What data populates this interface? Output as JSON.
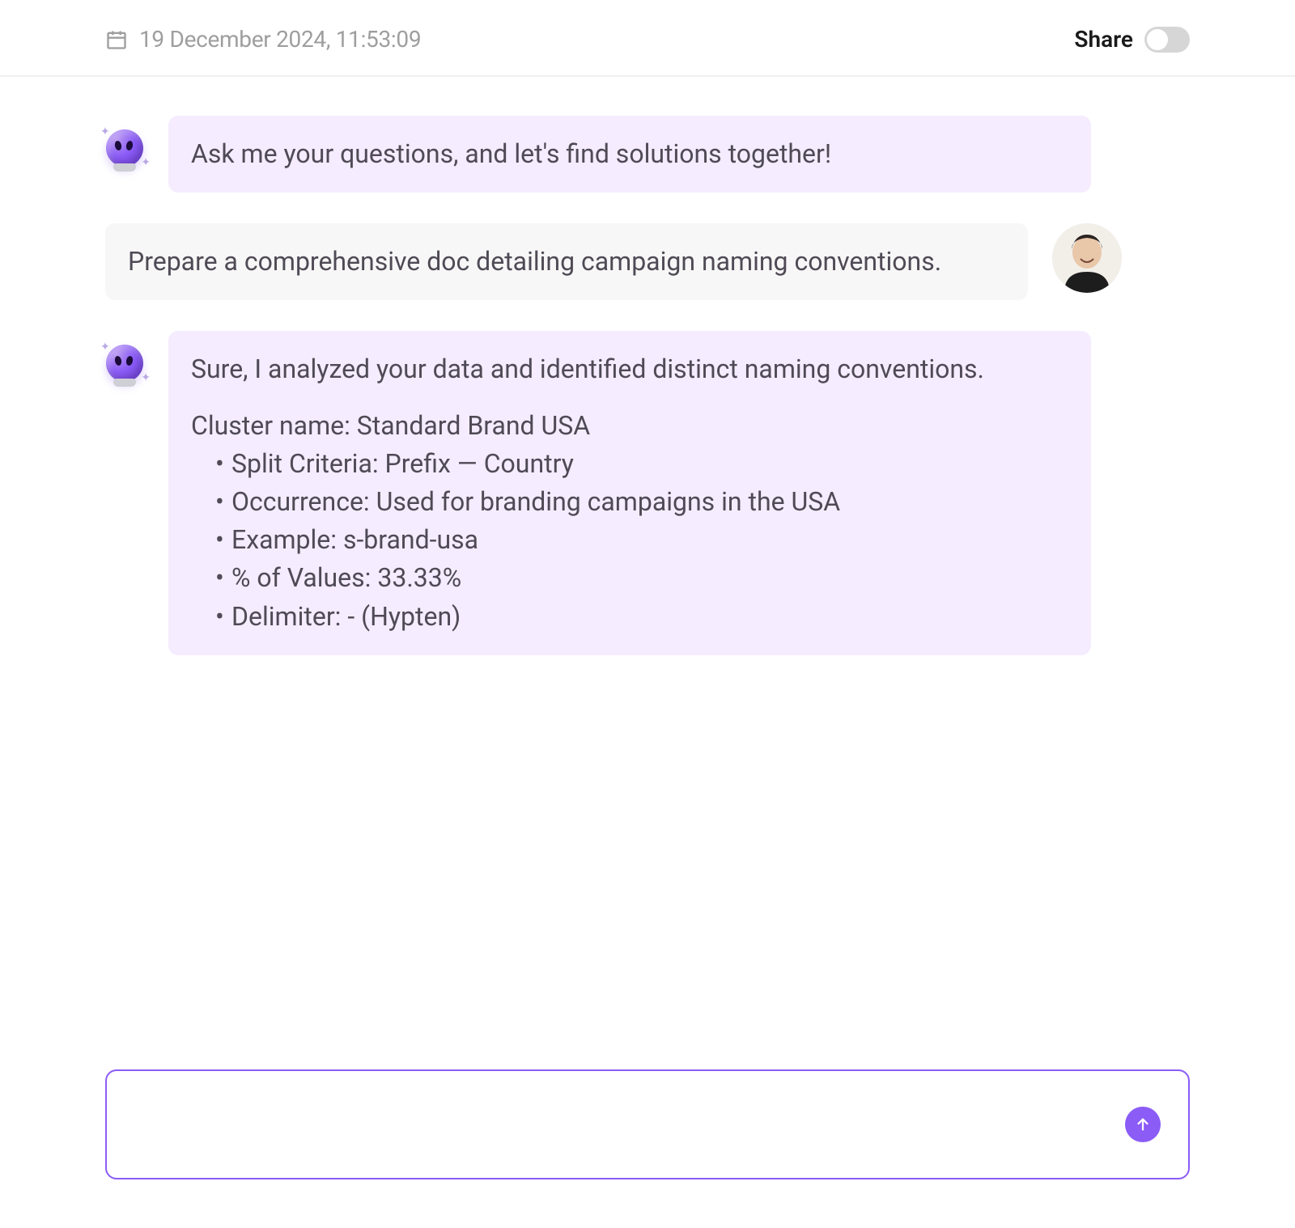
{
  "header": {
    "timestamp": "19 December 2024, 11:53:09",
    "share_label": "Share",
    "share_toggle_on": false
  },
  "chat": {
    "messages": [
      {
        "role": "assistant",
        "text": "Ask me your questions, and let's find solutions together!"
      },
      {
        "role": "user",
        "text": "Prepare a comprehensive doc detailing campaign naming conventions."
      },
      {
        "role": "assistant",
        "lead": "Sure, I analyzed your data and identified distinct naming conventions.",
        "cluster_title": "Cluster name: Standard Brand USA",
        "bullets": [
          "Split Criteria: Prefix  — Country",
          "Occurrence: Used for branding campaigns in the USA",
          "Example: s-brand-usa",
          "% of Values: 33.33%",
          "Delimiter: - (Hypten)"
        ]
      }
    ]
  },
  "composer": {
    "placeholder": "",
    "value": ""
  },
  "icons": {
    "calendar": "calendar-icon",
    "send": "arrow-up-icon",
    "assistant": "crystal-ball-alien-icon",
    "user": "user-photo-avatar"
  },
  "colors": {
    "accent": "#8b5cf6",
    "assistant_bubble": "#f5ecff",
    "user_bubble": "#f7f7f7",
    "text": "#4f4a55",
    "muted": "#9e9e9e"
  }
}
